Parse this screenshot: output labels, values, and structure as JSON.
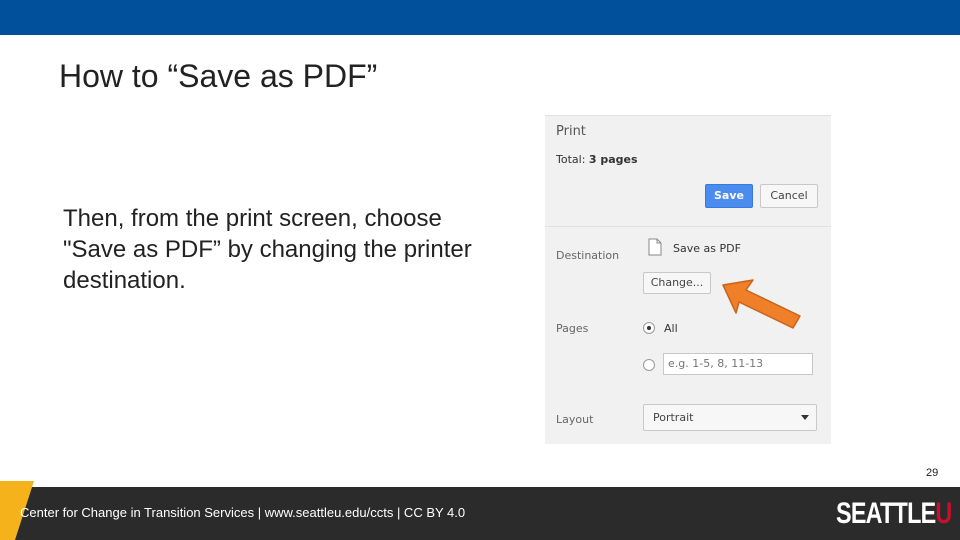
{
  "slide": {
    "title": "How to “Save as PDF”",
    "body": "Then, from the print screen, choose \"Save as PDF” by changing the printer destination.",
    "page_number": "29"
  },
  "print_dialog": {
    "heading": "Print",
    "total_label": "Total:",
    "total_value": "3 pages",
    "save_label": "Save",
    "cancel_label": "Cancel",
    "destination_label": "Destination",
    "destination_value": "Save as PDF",
    "change_label": "Change...",
    "pages_label": "Pages",
    "pages_all_label": "All",
    "pages_all_selected": true,
    "pages_custom_placeholder": "e.g. 1-5, 8, 11-13",
    "layout_label": "Layout",
    "layout_value": "Portrait",
    "icons": {
      "destination": "document-icon",
      "layout": "chevron-down-icon"
    }
  },
  "annotation": {
    "icon": "arrow-icon",
    "color": "#f07f2a"
  },
  "footer": {
    "text": "Center for Change in Transition Services | www.seattleu.edu/ccts | CC BY 4.0",
    "logo_main": "SEATTLE",
    "logo_accent": "U"
  },
  "colors": {
    "top_bar": "#00509b",
    "footer_bar": "#2b2b2b",
    "footer_accent": "#f5b21b",
    "save_button": "#4a8cf0",
    "logo_accent": "#c8102e"
  }
}
